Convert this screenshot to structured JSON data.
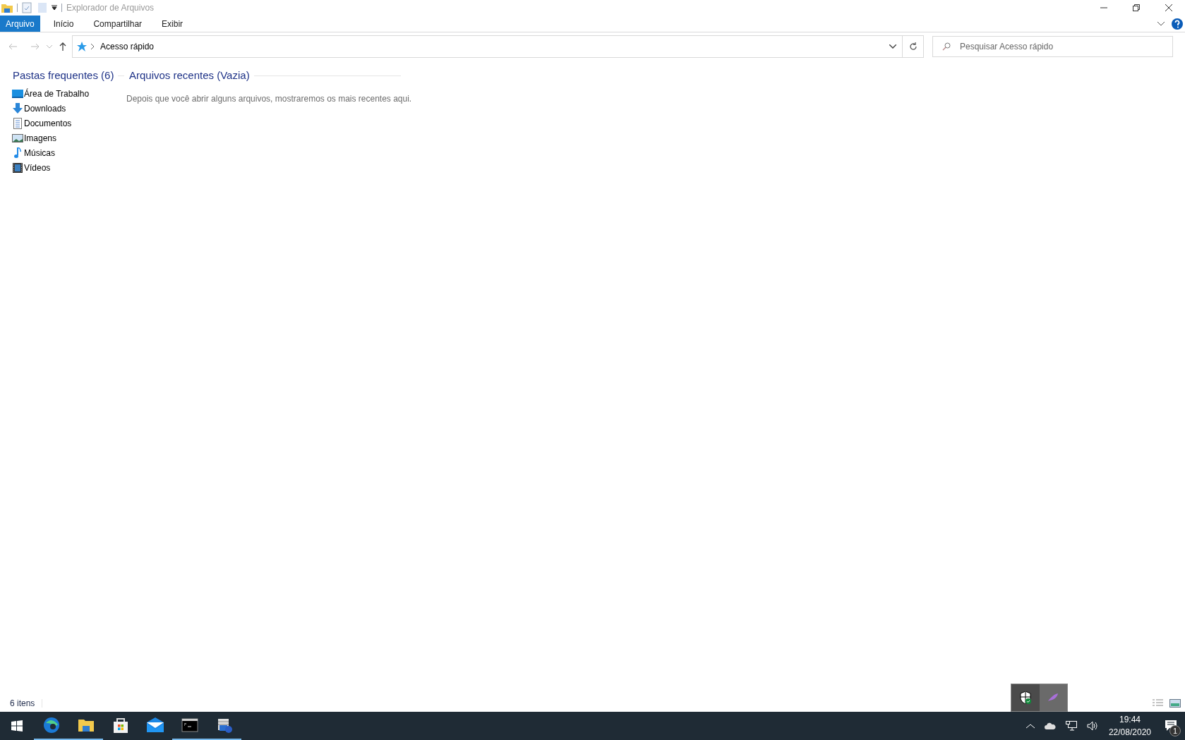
{
  "window": {
    "title": "Explorador de Arquivos"
  },
  "ribbon_tabs": [
    {
      "label": "Arquivo",
      "selected": true
    },
    {
      "label": "Início",
      "selected": false
    },
    {
      "label": "Compartilhar",
      "selected": false
    },
    {
      "label": "Exibir",
      "selected": false
    }
  ],
  "address_bar": {
    "path": "Acesso rápido"
  },
  "search": {
    "placeholder": "Pesquisar Acesso rápido"
  },
  "frequent_folders": {
    "heading": "Pastas frequentes (6)",
    "items": [
      {
        "label": "Área de Trabalho",
        "kind": "desktop"
      },
      {
        "label": "Downloads",
        "kind": "downloads"
      },
      {
        "label": "Documentos",
        "kind": "documents"
      },
      {
        "label": "Imagens",
        "kind": "pictures"
      },
      {
        "label": "Músicas",
        "kind": "music"
      },
      {
        "label": "Vídeos",
        "kind": "videos"
      }
    ]
  },
  "recent_files": {
    "heading": "Arquivos recentes (Vazia)",
    "empty_message": "Depois que você abrir alguns arquivos, mostraremos os mais recentes aqui."
  },
  "status_bar": {
    "item_count": "6 itens"
  },
  "taskbar": {
    "apps": [
      {
        "kind": "edge",
        "running": true
      },
      {
        "kind": "explorer",
        "running": true
      },
      {
        "kind": "store",
        "running": false
      },
      {
        "kind": "mail",
        "running": false
      },
      {
        "kind": "terminal",
        "running": true
      },
      {
        "kind": "setup",
        "running": true
      }
    ],
    "time": "19:44",
    "date": "22/08/2020",
    "notifications": "1"
  }
}
